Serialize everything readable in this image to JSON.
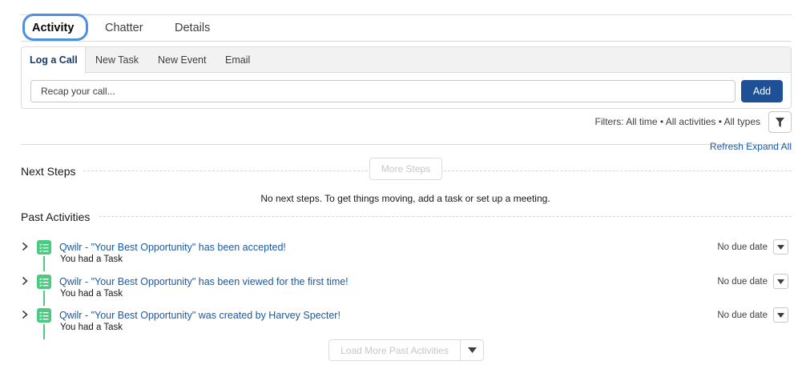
{
  "main_tabs": [
    {
      "label": "Activity",
      "active": true
    },
    {
      "label": "Chatter",
      "active": false
    },
    {
      "label": "Details",
      "active": false
    }
  ],
  "publisher": {
    "tabs": [
      {
        "label": "Log a Call",
        "active": true
      },
      {
        "label": "New Task",
        "active": false
      },
      {
        "label": "New Event",
        "active": false
      },
      {
        "label": "Email",
        "active": false
      }
    ],
    "input_placeholder": "Recap your call...",
    "add_label": "Add"
  },
  "filters": {
    "text": "Filters: All time • All activities • All types",
    "icon": "filter-icon"
  },
  "links": {
    "refresh": "Refresh",
    "expand_all": "Expand All"
  },
  "next_steps": {
    "title": "Next Steps",
    "more_steps_label": "More Steps",
    "empty_message": "No next steps. To get things moving, add a task or set up a meeting."
  },
  "past_activities": {
    "title": "Past Activities",
    "items": [
      {
        "title": "Qwilr - \"Your Best Opportunity\" has been accepted!",
        "subtitle": "You had a Task",
        "due": "No due date",
        "icon": "task-icon"
      },
      {
        "title": "Qwilr - \"Your Best Opportunity\" has been viewed for the first time!",
        "subtitle": "You had a Task",
        "due": "No due date",
        "icon": "task-icon"
      },
      {
        "title": "Qwilr - \"Your Best Opportunity\" was created by Harvey Specter!",
        "subtitle": "You had a Task",
        "due": "No due date",
        "icon": "task-icon"
      }
    ],
    "load_more_label": "Load More Past Activities"
  },
  "colors": {
    "brand_button": "#1f4f94",
    "link": "#1a5aa6",
    "task_green": "#4bca81",
    "highlight_ring": "#4e8fde"
  }
}
